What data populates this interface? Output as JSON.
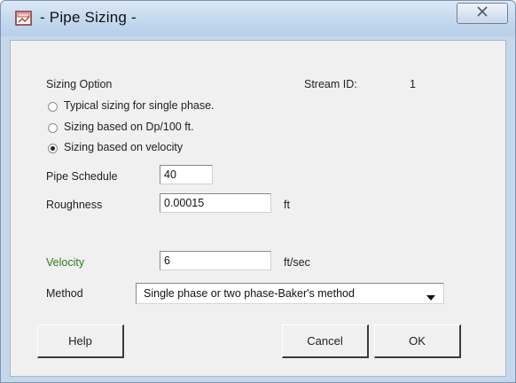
{
  "window": {
    "title": "- Pipe Sizing -"
  },
  "icons": {
    "app": "app-icon",
    "close": "close-icon",
    "dropdown": "chevron-down-icon"
  },
  "sizing": {
    "label": "Sizing Option",
    "stream_id_label": "Stream ID:",
    "stream_id_value": "1",
    "options": [
      {
        "label": "Typical sizing for single phase.",
        "selected": false
      },
      {
        "label": "Sizing based on Dp/100 ft.",
        "selected": false
      },
      {
        "label": "Sizing based on velocity",
        "selected": true
      }
    ]
  },
  "pipe_schedule": {
    "label": "Pipe Schedule",
    "value": "40"
  },
  "roughness": {
    "label": "Roughness",
    "value": "0.00015",
    "unit": "ft"
  },
  "velocity": {
    "label": "Velocity",
    "value": "6",
    "unit": "ft/sec",
    "label_color": "#2e7d1b"
  },
  "method": {
    "label": "Method",
    "selected": "Single phase or two phase-Baker's method"
  },
  "buttons": {
    "help": "Help",
    "cancel": "Cancel",
    "ok": "OK"
  }
}
